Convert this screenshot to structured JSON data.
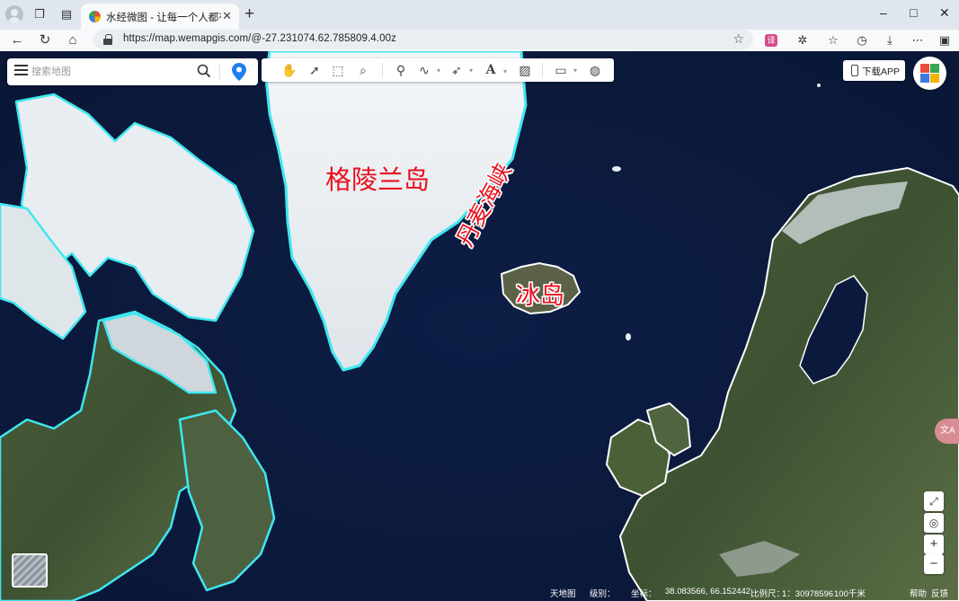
{
  "browser": {
    "tab_title": "水经微图 - 让每一个人都有自己的",
    "url": "https://map.wemapgis.com/@-27.231074.62.785809.4.00z",
    "window_controls": [
      "–",
      "□",
      "✕"
    ]
  },
  "search": {
    "placeholder": "搜索地图"
  },
  "toolbar": {
    "tools": [
      "pan-hand",
      "select-arrow",
      "box-select",
      "zoom-search",
      "marker",
      "polyline",
      "arrow-line",
      "text",
      "image",
      "ruler",
      "globe"
    ]
  },
  "header_right": {
    "download_label": "下载APP"
  },
  "labels": {
    "greenland": "格陵兰岛",
    "denmark_strait": "丹麦海峡",
    "iceland": "冰岛"
  },
  "controls": {
    "zoom_in": "+",
    "zoom_out": "−",
    "translate": "文A"
  },
  "status": {
    "basemap": "天地图",
    "level_label": "级别：",
    "coord_label": "坐标：",
    "coords": "38.083566, 66.152442",
    "scale_label": "比例尺：",
    "scale_value": "1：30978596",
    "scale_bar": "100千米",
    "help": "帮助",
    "feedback": "反馈"
  },
  "colors": {
    "ocean": "#0b1a3c",
    "label_red": "#e8101e",
    "coast_cyan": "#3fe7f0",
    "coast_white": "#ffffff"
  }
}
